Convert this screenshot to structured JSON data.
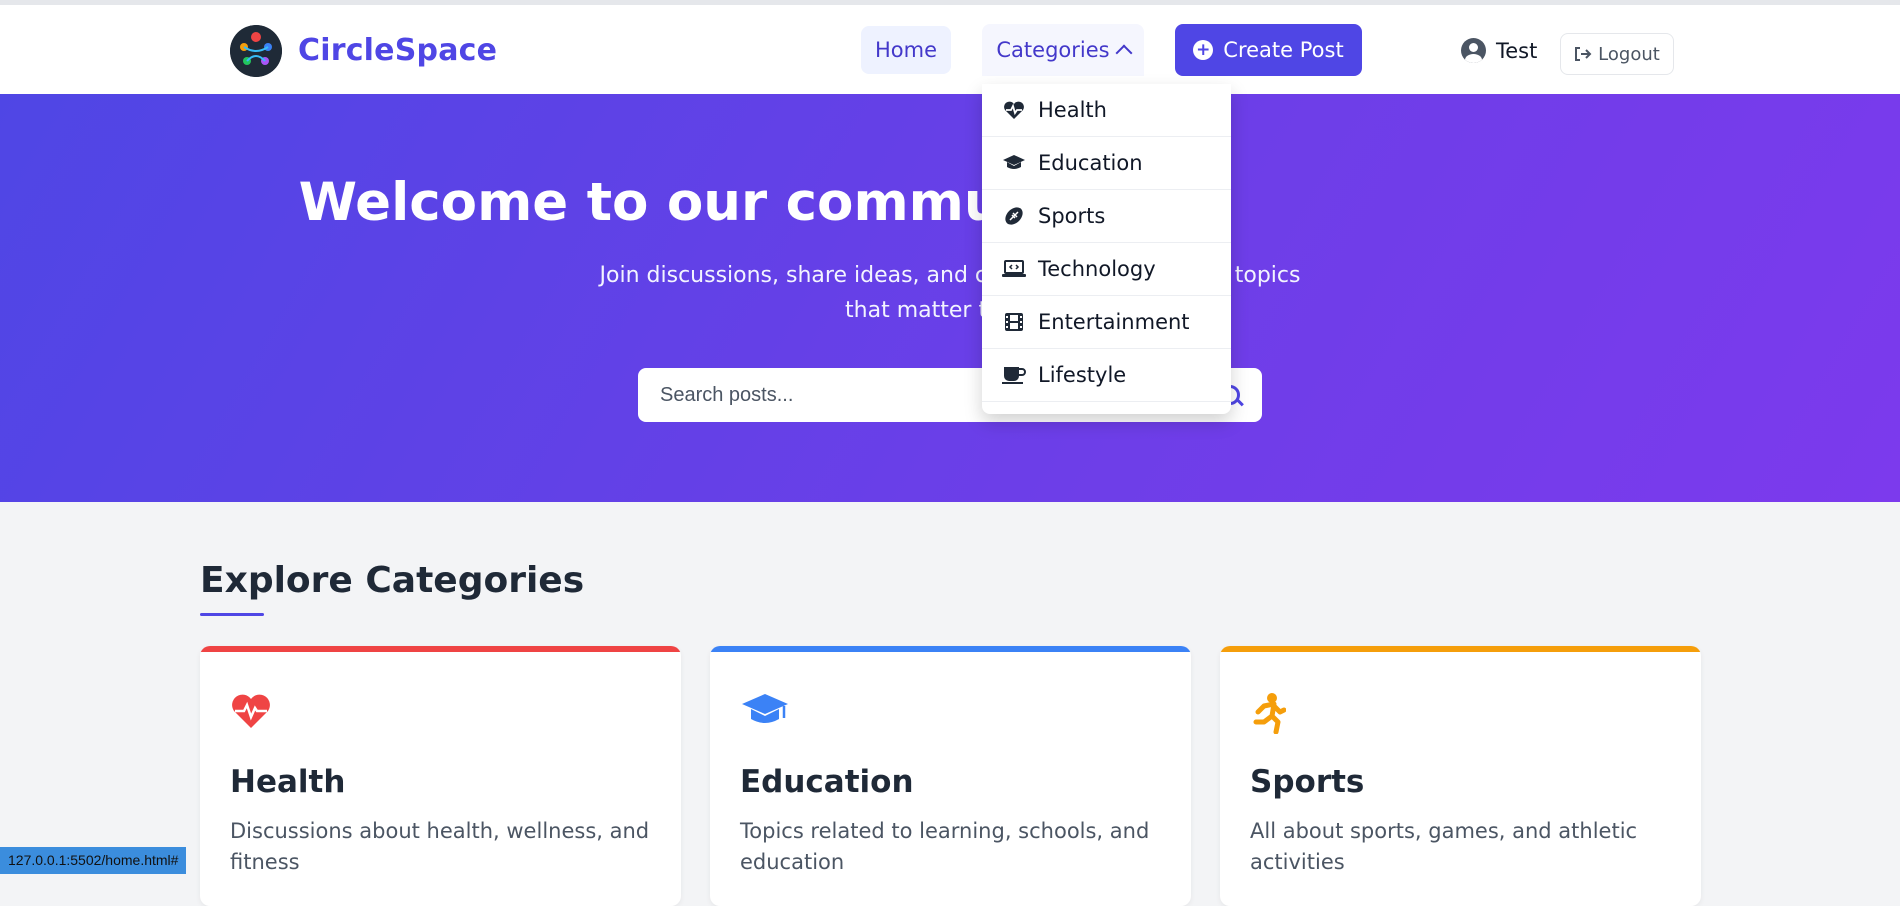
{
  "brand": {
    "name": "CircleSpace"
  },
  "nav": {
    "home": "Home",
    "categories": "Categories",
    "create_post": "Create Post",
    "user_name": "Test",
    "logout": "Logout"
  },
  "dropdown": {
    "items": [
      {
        "label": "Health",
        "icon": "heartbeat-icon"
      },
      {
        "label": "Education",
        "icon": "graduation-cap-icon"
      },
      {
        "label": "Sports",
        "icon": "football-icon"
      },
      {
        "label": "Technology",
        "icon": "laptop-code-icon"
      },
      {
        "label": "Entertainment",
        "icon": "film-icon"
      },
      {
        "label": "Lifestyle",
        "icon": "coffee-cup-icon"
      }
    ]
  },
  "hero": {
    "title": "Welcome to our community",
    "subtitle": "Join discussions, share ideas, and connect with others on topics that matter to you.",
    "search_placeholder": "Search posts..."
  },
  "categories_section": {
    "title": "Explore Categories",
    "cards": [
      {
        "title": "Health",
        "description": "Discussions about health, wellness, and fitness",
        "color": "#ef4444",
        "icon": "heartbeat-icon"
      },
      {
        "title": "Education",
        "description": "Topics related to learning, schools, and education",
        "color": "#3b82f6",
        "icon": "graduation-cap-icon"
      },
      {
        "title": "Sports",
        "description": "All about sports, games, and athletic activities",
        "color": "#f59e0b",
        "icon": "running-icon"
      }
    ]
  },
  "status_bar": {
    "url": "127.0.0.1:5502/home.html#"
  },
  "colors": {
    "accent": "#4f46e5",
    "hero_start": "#4f46e5",
    "hero_end": "#7c3aed"
  }
}
